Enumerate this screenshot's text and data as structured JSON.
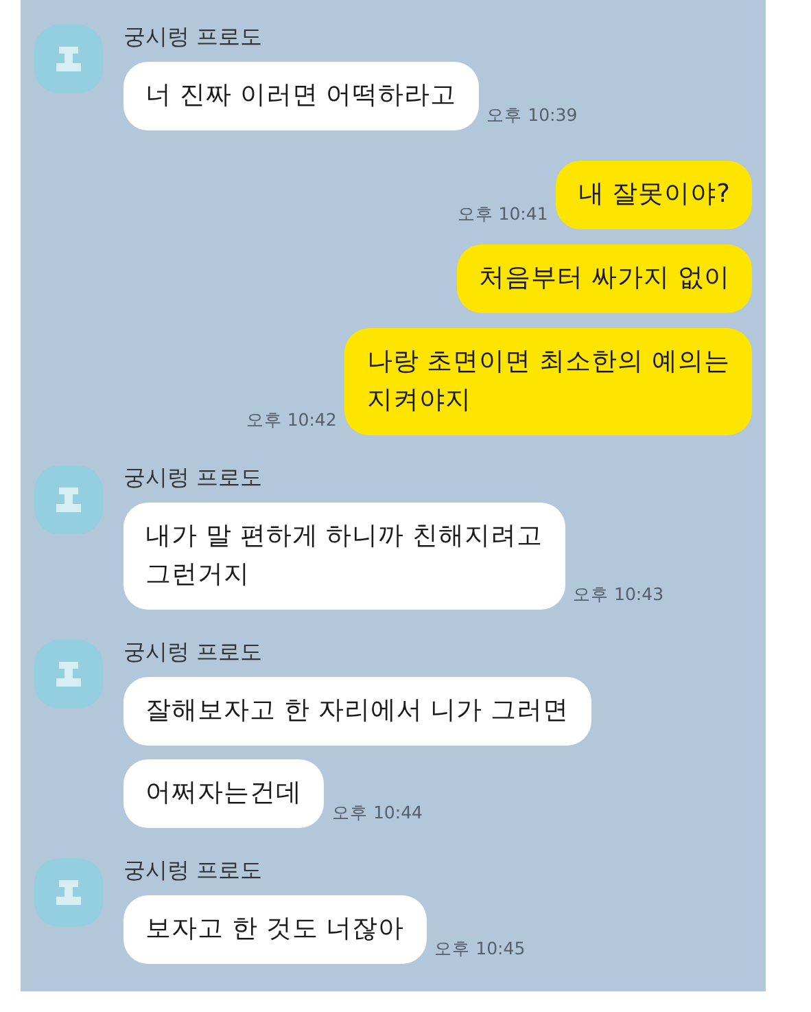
{
  "chat": [
    {
      "kind": "received",
      "sender": "궁시렁 프로도",
      "messages": [
        {
          "text": "너 진짜 이러면 어떡하라고",
          "time": "오후 10:39"
        }
      ]
    },
    {
      "kind": "sent",
      "messages": [
        {
          "text": "내 잘못이야?",
          "time": "오후 10:41"
        },
        {
          "text": "처음부터 싸가지 없이"
        },
        {
          "text": "나랑 초면이면 최소한의 예의는\n지켜야지",
          "time": "오후 10:42"
        }
      ]
    },
    {
      "kind": "received",
      "sender": "궁시렁 프로도",
      "messages": [
        {
          "text": "내가 말 편하게 하니까 친해지려고\n그런거지",
          "time": "오후 10:43"
        }
      ]
    },
    {
      "kind": "received",
      "sender": "궁시렁 프로도",
      "messages": [
        {
          "text": "잘해보자고 한 자리에서 니가 그러면"
        },
        {
          "text": "어쩌자는건데",
          "time": "오후 10:44"
        }
      ]
    },
    {
      "kind": "received",
      "sender": "궁시렁 프로도",
      "messages": [
        {
          "text": "보자고 한 것도 너잖아",
          "time": "오후 10:45"
        }
      ]
    }
  ]
}
